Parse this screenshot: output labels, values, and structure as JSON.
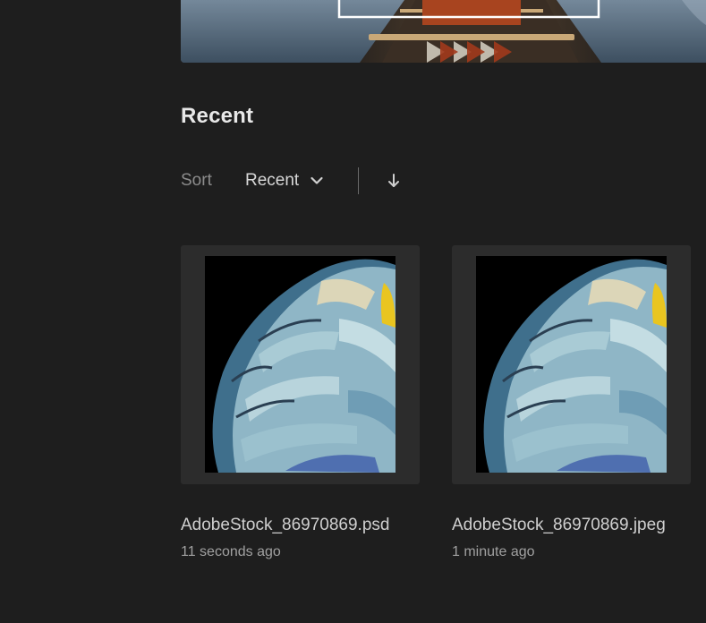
{
  "recent": {
    "title": "Recent",
    "sort_label": "Sort",
    "sort_value": "Recent",
    "sort_direction_icon": "arrow-down-icon"
  },
  "files": [
    {
      "name": "AdobeStock_86970869.psd",
      "modified": "11 seconds ago"
    },
    {
      "name": "AdobeStock_86970869.jpeg",
      "modified": "1 minute ago"
    }
  ],
  "colors": {
    "background": "#1e1e1e",
    "thumbnail_frame": "#2c2c2c",
    "text_primary": "#e6e6e6",
    "text_muted": "#8c8c8c"
  }
}
